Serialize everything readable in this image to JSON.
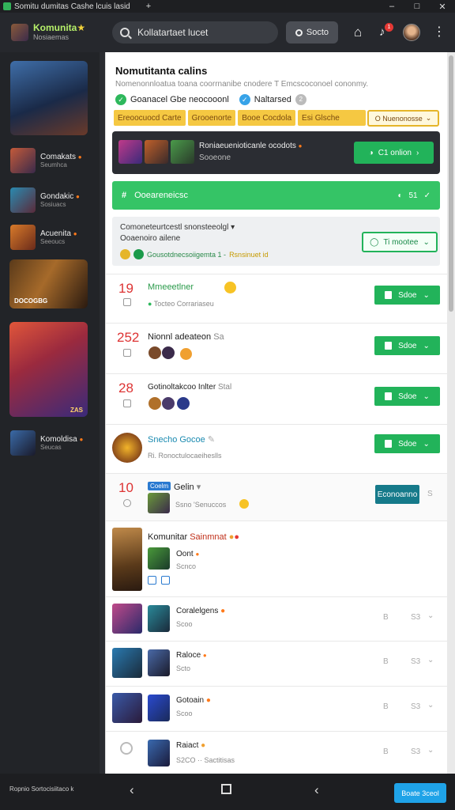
{
  "window": {
    "title": "Somitu dumitas Cashe lcuis lasid",
    "new_tab": "+",
    "controls": [
      "–",
      "□",
      "✕"
    ]
  },
  "topbar": {
    "brand_name": "Komunita",
    "brand_badge": "★",
    "brand_sub": "Nosiaemas",
    "search_text": "Kollatartaet lucet",
    "search_button": "Socto",
    "notifications_badge": "1",
    "icons": [
      "search-icon",
      "home-icon",
      "bell-icon",
      "avatar",
      "more-icon"
    ]
  },
  "sidebar": {
    "items": [
      {
        "title": "Comakats",
        "sub": "Seumhca"
      },
      {
        "title": "Gondakic",
        "sub": "Sosiuacs"
      },
      {
        "title": "Acuenita",
        "sub": "Seeoucs"
      },
      {
        "title": "Komoldisa",
        "sub": "Seucas"
      }
    ],
    "banner1_caption": "DOCOGBG",
    "banner2_caption": "ZAS"
  },
  "main": {
    "title": "Nomutitanta calins",
    "subtitle": "Nomenonnloatua toana coorrnanibe cnodere T Emcscoconoel cononmy.",
    "check1": "Goanacel Gbe neocooonl",
    "check2": "Naltarsed",
    "check2_count": "2",
    "chips": [
      "Ereoocuocd Carte",
      "Grooenorte",
      "Booe Cocdola",
      "Esi Glsche"
    ],
    "chip_selected": "O Nuenonosse",
    "featured": {
      "title": "Roniaeuenioticanle ocodots",
      "sub": "Sooeone",
      "button": "C1 onlion"
    },
    "greenbar": {
      "icon": "#",
      "label": "Ooeareneicsc",
      "count": "51"
    },
    "info": {
      "line1": "Comoneteurtcestl snonsteeolgl",
      "line2": "Ooaenoiro ailene",
      "line3_lead": "Gousotdnecsoiigemta 1 -",
      "line3_tail": "Rsnsinuet id",
      "button": "Ti mootee"
    },
    "rows": [
      {
        "num": "19",
        "title": "Mmeeetlner",
        "meta": "Tocteo Corrariaseu",
        "button": "Sdoe"
      },
      {
        "num": "252",
        "title": "Nionnl adeateon",
        "extra": "Sa",
        "button": "Sdoe"
      },
      {
        "num": "28",
        "title": "Gotinoltakcoo Inlter",
        "extra": "Stal",
        "button": "Sdoe"
      },
      {
        "title": "Snecho Gocoe",
        "meta": "Ri. Ronoctulocaeiheslls",
        "button": "Sdoe"
      },
      {
        "num": "10",
        "badge": "Coelm",
        "title": "Gelin",
        "meta": "Ssno 'Senuccos",
        "button": "Econoanno",
        "ghost": "S"
      },
      {
        "title": "Komunitar",
        "title_accent": "Sainmnat",
        "sub1": "Oont",
        "sub2": "Scnco"
      },
      {
        "title": "Coralelgens",
        "meta": "Scoo",
        "ghost_a": "B",
        "ghost_b": "S3"
      },
      {
        "title": "Raloce",
        "meta": "Scto",
        "ghost_a": "B",
        "ghost_b": "S3"
      },
      {
        "title": "Gotoain",
        "meta": "Scoo",
        "ghost_a": "B",
        "ghost_b": "S3"
      },
      {
        "title": "Raiact",
        "meta": "S2CO ·· Sactitisas",
        "ghost_a": "B",
        "ghost_b": "S3"
      }
    ]
  },
  "bottombar": {
    "caption": "Ropnio Sortocisiitaco k",
    "cta": "Boate 3ceol"
  },
  "colors": {
    "accent_green": "#22b35a",
    "warning_yellow": "#f5c842",
    "dark_panel": "#2b2d33",
    "teal": "#167a8a",
    "cta_blue": "#1fa3e8"
  }
}
